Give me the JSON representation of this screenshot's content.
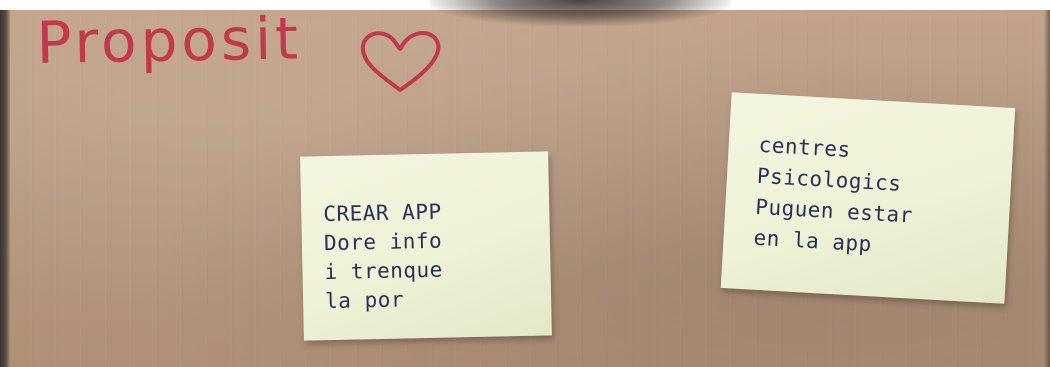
{
  "scene": {
    "title": "Proposit",
    "title_color": "#c4394a",
    "title_symbol": "heart-outline",
    "paper_color": "#b8987f",
    "note_color": "#eef2d6",
    "ink_color": "#2b2f5a"
  },
  "notes": [
    {
      "lines": [
        "CREAR APP",
        "Dore info",
        "i trenque",
        "la por"
      ]
    },
    {
      "lines": [
        "centres",
        "Psicologics",
        "Puguen estar",
        "en la app"
      ]
    }
  ]
}
